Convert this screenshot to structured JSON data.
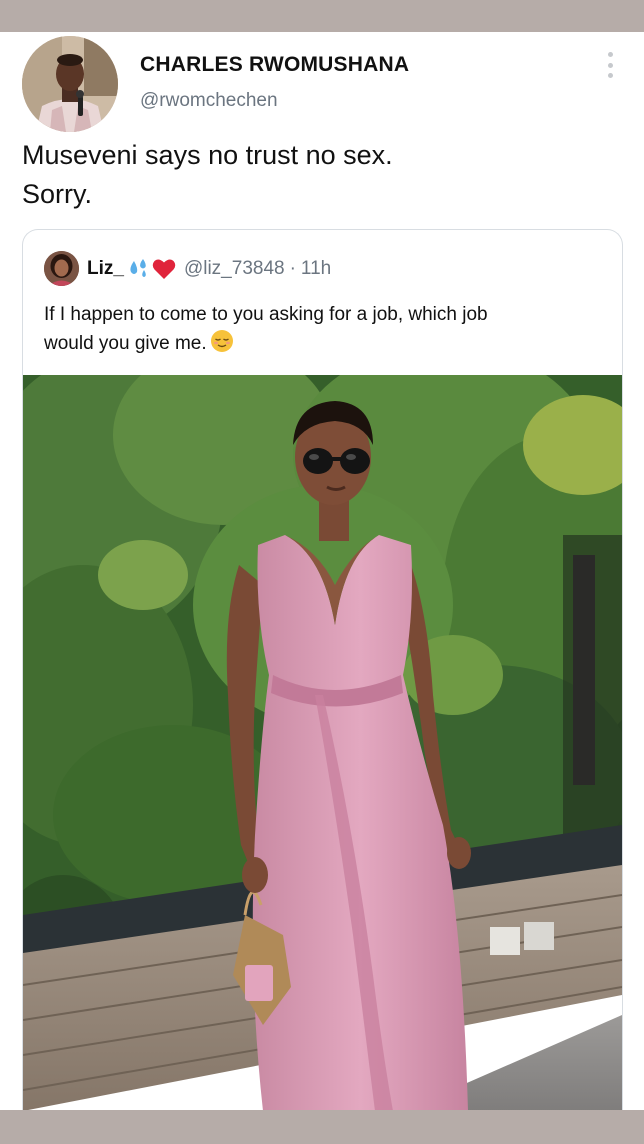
{
  "tweet": {
    "author_name": "CHARLES RWOMUSHANA",
    "author_handle": "@rwomchechen",
    "text_lines": [
      "Museveni says no trust no sex.",
      "Sorry."
    ],
    "avatar_icon": "profile-photo-man-with-microphone",
    "more_icon": "vertical-ellipsis-icon"
  },
  "quoted_tweet": {
    "author_name": "Liz_",
    "name_emojis": [
      "sweat-droplets-emoji",
      "red-heart-emoji"
    ],
    "author_handle": "@liz_73848",
    "separator": "·",
    "time": "11h",
    "text_lines": [
      "If I happen to come to you asking for a job, which job",
      "would you give me."
    ],
    "trailing_emoji": "relieved-face-emoji",
    "image": "photo-woman-pink-dress-sunglasses-in-front-of-foliage"
  },
  "colors": {
    "background": "#b6aca8",
    "card": "#ffffff",
    "text_primary": "#111111",
    "text_secondary": "#6b7580",
    "border": "#d8dde2",
    "dress_pink": "#d99bb4",
    "foliage_green": "#4e7a3a"
  }
}
